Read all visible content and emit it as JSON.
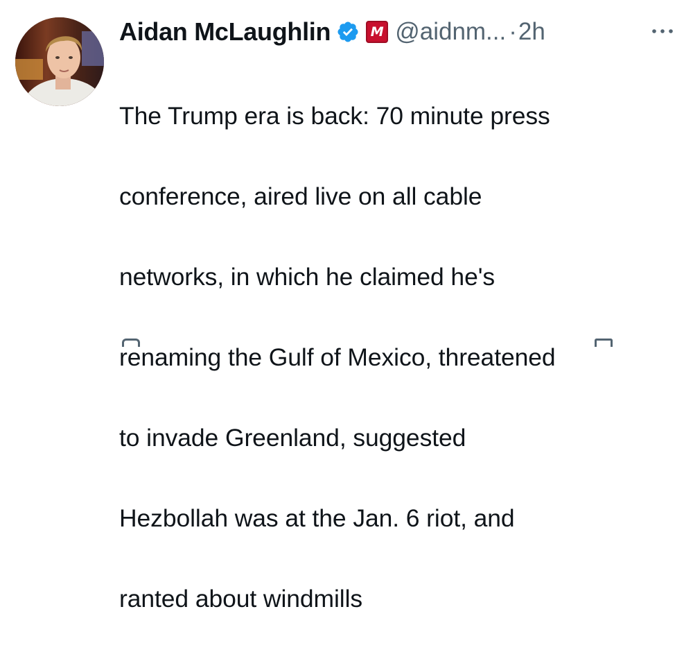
{
  "tweet": {
    "display_name": "Aidan McLaughlin",
    "handle": "@aidnm...",
    "separator": "·",
    "time": "2h",
    "affiliation_badge": "M",
    "body_lines": [
      "The Trump era is back: 70 minute press",
      "conference, aired live on all cable",
      "networks, in which he claimed he's",
      "renaming the Gulf of Mexico, threatened",
      "to invade Greenland, suggested",
      "Hezbollah was at the Jan. 6 riot, and",
      "ranted about windmills"
    ]
  },
  "icons": {
    "verified": "verified-badge-icon",
    "more": "more-options-icon"
  },
  "colors": {
    "text": "#0f1419",
    "secondary": "#536471",
    "verified": "#1d9bf0",
    "affiliation": "#c8102e"
  }
}
